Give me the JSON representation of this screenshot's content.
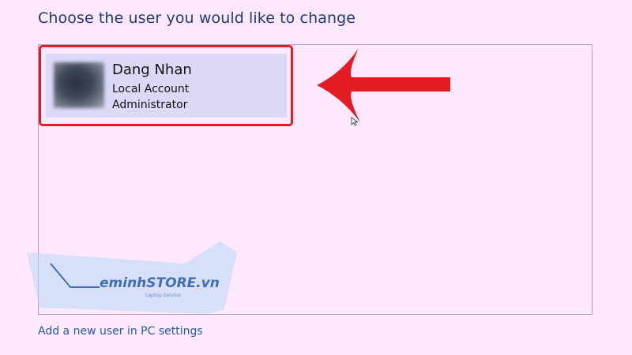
{
  "page": {
    "title": "Choose the user you would like to change"
  },
  "user_list": {
    "users": [
      {
        "name": "Dang Nhan",
        "account_type": "Local Account",
        "role": "Administrator"
      }
    ]
  },
  "footer": {
    "add_user_link": "Add a new user in PC settings"
  },
  "watermark": {
    "brand": "eminhSTORE.vn",
    "tagline": "Laptop Service"
  },
  "annotation": {
    "highlight_color": "#e31b23",
    "arrow_icon": "left-arrow-icon"
  },
  "colors": {
    "background": "#fde8fd",
    "title": "#1f3a80",
    "tile": "#dcd9f8",
    "link": "#245aa6"
  }
}
